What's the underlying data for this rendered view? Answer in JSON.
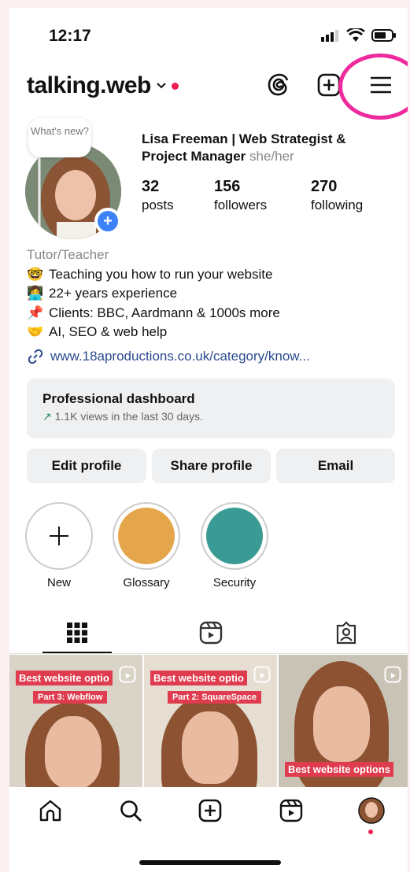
{
  "status_bar": {
    "time": "12:17"
  },
  "header": {
    "username": "talking.web"
  },
  "note": {
    "text": "What's new?"
  },
  "profile": {
    "name": "Lisa Freeman | Web Strategist & Project Manager",
    "pronouns": "she/her",
    "stats": [
      {
        "num": "32",
        "label": "posts"
      },
      {
        "num": "156",
        "label": "followers"
      },
      {
        "num": "270",
        "label": "following"
      }
    ],
    "category": "Tutor/Teacher",
    "bio_lines": [
      {
        "emoji": "🤓",
        "text": "Teaching you how to run your website"
      },
      {
        "emoji": "👩‍💻",
        "text": "22+ years experience"
      },
      {
        "emoji": "📌",
        "text": "Clients: BBC, Aardmann & 1000s more"
      },
      {
        "emoji": "🤝",
        "text": "AI, SEO & web help"
      }
    ],
    "link": "www.18aproductions.co.uk/category/know..."
  },
  "dashboard": {
    "title": "Professional dashboard",
    "subtitle": "1.1K views in the last 30 days."
  },
  "buttons": {
    "edit": "Edit profile",
    "share": "Share profile",
    "email": "Email"
  },
  "highlights": [
    {
      "label": "New"
    },
    {
      "label": "Glossary",
      "color": "#e5a54b"
    },
    {
      "label": "Security",
      "color": "#3a9b94"
    }
  ],
  "posts": [
    {
      "title": "Best website optio",
      "subtitle": "Part 3: Webflow"
    },
    {
      "title": "Best website optio",
      "subtitle": "Part 2: SquareSpace"
    },
    {
      "title": "Best website options"
    }
  ],
  "colors": {
    "accent_red": "#ee1d52",
    "highlight_pink": "#ee2a9c",
    "link_blue": "#2b4a8e",
    "badge_blue": "#3b82f6"
  }
}
